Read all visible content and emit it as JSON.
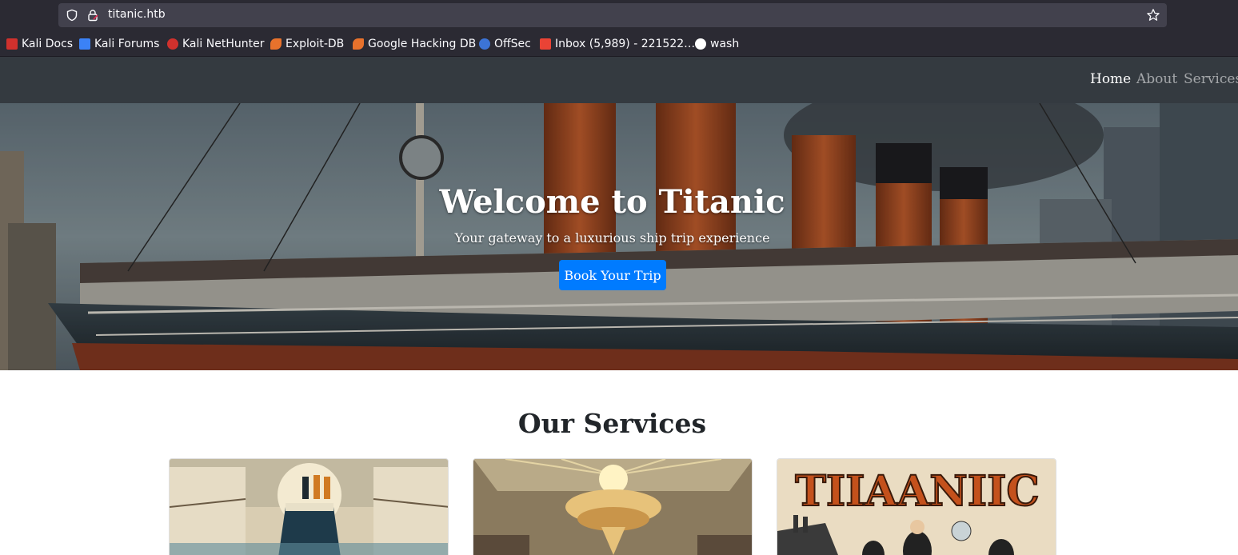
{
  "browser": {
    "url": "titanic.htb",
    "bookmarks": [
      {
        "label": "Kali Docs",
        "icon": "kali-docs-icon",
        "color": "#d0312d"
      },
      {
        "label": "Kali Forums",
        "icon": "kali-forums-icon",
        "color": "#3b82f6"
      },
      {
        "label": "Kali NetHunter",
        "icon": "kali-nethunter-icon",
        "color": "#d0312d"
      },
      {
        "label": "Exploit-DB",
        "icon": "exploit-db-icon",
        "color": "#e8722c"
      },
      {
        "label": "Google Hacking DB",
        "icon": "ghdb-icon",
        "color": "#e8722c"
      },
      {
        "label": "OffSec",
        "icon": "offsec-icon",
        "color": "#3c74d6"
      },
      {
        "label": "Inbox (5,989) - 221522…",
        "icon": "gmail-icon",
        "color": "#ea4335"
      },
      {
        "label": "wash",
        "icon": "github-icon",
        "color": "#ffffff"
      }
    ]
  },
  "nav": {
    "home": "Home",
    "about": "About",
    "services": "Services"
  },
  "hero": {
    "title": "Welcome to Titanic",
    "subtitle": "Your gateway to a luxurious ship trip experience",
    "button": "Book Your Trip"
  },
  "services": {
    "title": "Our Services",
    "card3_poster_text": "TIIAANIIC"
  },
  "colors": {
    "navbar": "#343a40",
    "primary": "#007bff",
    "chrome": "#2b2a33"
  }
}
